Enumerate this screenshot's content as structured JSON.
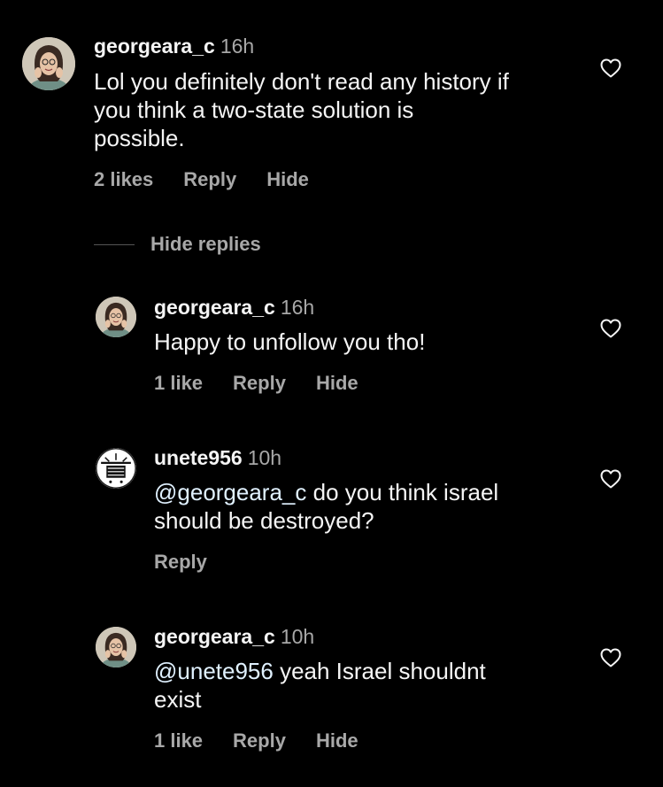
{
  "comments": [
    {
      "user": "georgeara_c",
      "time": "16h",
      "text_lines": [
        "Lol you definitely don't read any history if",
        "you think a two-state solution is",
        "possible."
      ],
      "likes": "2 likes",
      "reply": "Reply",
      "hide": "Hide",
      "avatar_icon": "profile-photo-icon"
    }
  ],
  "hide_replies_label": "Hide replies",
  "replies": [
    {
      "user": "georgeara_c",
      "time": "16h",
      "text_lines": [
        "Happy to unfollow you tho!"
      ],
      "likes": "1 like",
      "reply": "Reply",
      "hide": "Hide"
    },
    {
      "user": "unete956",
      "time": "10h",
      "mention": "@georgeara_c",
      "text_after_mention": " do you think israel",
      "text_line2": "should be destroyed?",
      "reply": "Reply"
    },
    {
      "user": "georgeara_c",
      "time": "10h",
      "mention": "@unete956",
      "text_after_mention": " yeah Israel shouldnt",
      "text_line2": "exist",
      "likes": "1 like",
      "reply": "Reply",
      "hide": "Hide"
    }
  ],
  "colors": {
    "background": "#000000",
    "primary_text": "#f5f5f5",
    "secondary_text": "#a8a8a8",
    "mention": "#e0f1ff"
  }
}
